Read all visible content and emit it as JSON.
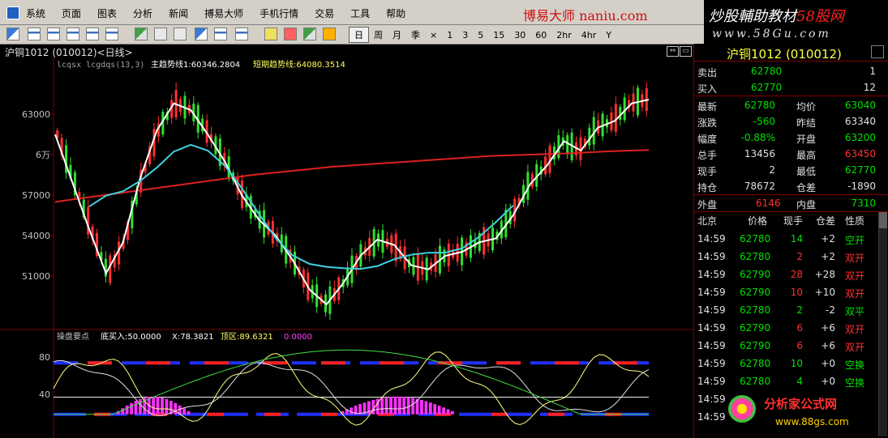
{
  "menubar": {
    "items": [
      "系统",
      "页面",
      "图表",
      "分析",
      "新闻",
      "搏易大师",
      "手机行情",
      "交易",
      "工具",
      "帮助"
    ],
    "brand": "博易大师 naniu.com"
  },
  "banner": {
    "line1_a": "炒股輔助教材",
    "line1_b": "58股网",
    "line2": "www.58Gu.com"
  },
  "toolbar": {
    "periods": [
      "日",
      "周",
      "月",
      "季",
      "×",
      "1",
      "3",
      "5",
      "15",
      "30",
      "60",
      "2hr",
      "4hr",
      "Y"
    ],
    "selected": "日"
  },
  "chart": {
    "title": "沪铜1012 (010012)<日线>",
    "legend_prefix": "lcqsx  lcgdqs(13,3)",
    "legend_main": "主趋势线1:60346.2804",
    "legend_short": "短期趋势线:64080.3514",
    "y_labels": [
      "63000",
      "6万",
      "57000",
      "54000",
      "51000"
    ],
    "sub_title": "操盘要点",
    "sub_buy": "底买入:50.0000",
    "sub_x": "X:78.3821",
    "sub_top": "顶区:89.6321",
    "sub_val": "0.0000",
    "sub_y_labels": [
      "80",
      "40"
    ]
  },
  "chart_data": {
    "type": "line",
    "title": "",
    "ylim": [
      48000,
      66000
    ],
    "y_ticks": [
      51000,
      54000,
      57000,
      60000,
      63000
    ],
    "bars": 135,
    "trend_main": [
      56500,
      56900,
      57300,
      57700,
      58100,
      58500,
      58800,
      59100,
      59300,
      59500,
      59700,
      59900,
      60000,
      60100,
      60250,
      60346
    ],
    "trend_short": [
      61500,
      58000,
      54500,
      51200,
      53500,
      58200,
      61800,
      63800,
      63300,
      61500,
      59500,
      57000,
      55200,
      54000,
      52200,
      50000,
      48900,
      50500,
      52500,
      53700,
      53300,
      51800,
      51500,
      52500,
      52800,
      53500,
      53800,
      55500,
      57800,
      59200,
      61000,
      60300,
      62000,
      62500,
      63800,
      64080
    ],
    "sub_ylim": [
      0,
      100
    ],
    "sub_y_ticks": [
      40,
      80
    ]
  },
  "quote": {
    "title": "沪铜1012 (010012)",
    "sell_label": "卖出",
    "sell_price": "62780",
    "sell_vol": "1",
    "buy_label": "买入",
    "buy_price": "62770",
    "buy_vol": "12",
    "rows": [
      {
        "l1": "最新",
        "v1": "62780",
        "c1": "green",
        "l2": "均价",
        "v2": "63040",
        "c2": "green"
      },
      {
        "l1": "涨跌",
        "v1": "-560",
        "c1": "green",
        "l2": "昨结",
        "v2": "63340",
        "c2": "white"
      },
      {
        "l1": "幅度",
        "v1": "-0.88%",
        "c1": "green",
        "l2": "开盘",
        "v2": "63200",
        "c2": "green"
      },
      {
        "l1": "总手",
        "v1": "13456",
        "c1": "white",
        "l2": "最高",
        "v2": "63450",
        "c2": "red"
      },
      {
        "l1": "现手",
        "v1": "2",
        "c1": "white",
        "l2": "最低",
        "v2": "62770",
        "c2": "green"
      },
      {
        "l1": "持仓",
        "v1": "78672",
        "c1": "white",
        "l2": "仓差",
        "v2": "-1890",
        "c2": "white"
      }
    ],
    "outer_label": "外盘",
    "outer_val": "6146",
    "inner_label": "内盘",
    "inner_val": "7310",
    "tick_header": [
      "北京",
      "价格",
      "现手",
      "仓差",
      "性质"
    ],
    "ticks": [
      {
        "t": "14:59",
        "p": "62780",
        "v": "14",
        "d": "+2",
        "n": "空开",
        "vc": "green",
        "nc": "green"
      },
      {
        "t": "14:59",
        "p": "62780",
        "v": "2",
        "d": "+2",
        "n": "双开",
        "vc": "red",
        "nc": "red"
      },
      {
        "t": "14:59",
        "p": "62790",
        "v": "28",
        "d": "+28",
        "n": "双开",
        "vc": "red",
        "nc": "red"
      },
      {
        "t": "14:59",
        "p": "62790",
        "v": "10",
        "d": "+10",
        "n": "双开",
        "vc": "red",
        "nc": "red"
      },
      {
        "t": "14:59",
        "p": "62780",
        "v": "2",
        "d": "-2",
        "n": "双平",
        "vc": "green",
        "nc": "green"
      },
      {
        "t": "14:59",
        "p": "62790",
        "v": "6",
        "d": "+6",
        "n": "双开",
        "vc": "red",
        "nc": "red"
      },
      {
        "t": "14:59",
        "p": "62790",
        "v": "6",
        "d": "+6",
        "n": "双开",
        "vc": "red",
        "nc": "red"
      },
      {
        "t": "14:59",
        "p": "62780",
        "v": "10",
        "d": "+0",
        "n": "空换",
        "vc": "green",
        "nc": "green"
      },
      {
        "t": "14:59",
        "p": "62780",
        "v": "4",
        "d": "+0",
        "n": "空换",
        "vc": "green",
        "nc": "green"
      },
      {
        "t": "14:59",
        "p": "",
        "v": "",
        "d": "",
        "n": "",
        "vc": "green",
        "nc": "green"
      },
      {
        "t": "14:59",
        "p": "",
        "v": "",
        "d": "",
        "n": "",
        "vc": "green",
        "nc": "green"
      }
    ]
  },
  "logo2": {
    "name": "分析家公式网",
    "url": "www.88gs.com"
  },
  "colors": {
    "up": "#ff3030",
    "down": "#00e000",
    "grid": "#800000",
    "trend_main": "#e02020",
    "trend_short": "#ffffff"
  }
}
